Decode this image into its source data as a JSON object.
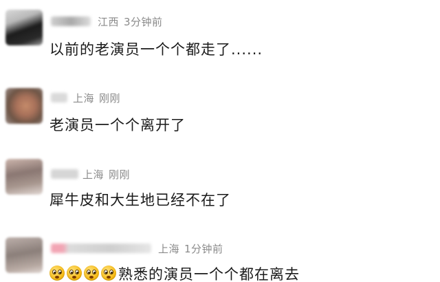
{
  "comments": [
    {
      "location": "江西",
      "time": "3分钟前",
      "text": "以前的老演员一个个都走了......"
    },
    {
      "location": "上海",
      "time": "刚刚",
      "text": "老演员一个个离开了"
    },
    {
      "location": "上海",
      "time": "刚刚",
      "text": "犀牛皮和大生地已经不在了"
    },
    {
      "location": "上海",
      "time": "1分钟前",
      "text": "熟悉的演员一个个都在离去",
      "emoji_names": [
        "flushed-face-icon",
        "flushed-face-icon",
        "flushed-face-icon",
        "flushed-face-icon"
      ]
    }
  ],
  "colors": {
    "meta": "#8a8a8a",
    "text": "#1a1a1a",
    "background": "#ffffff"
  }
}
